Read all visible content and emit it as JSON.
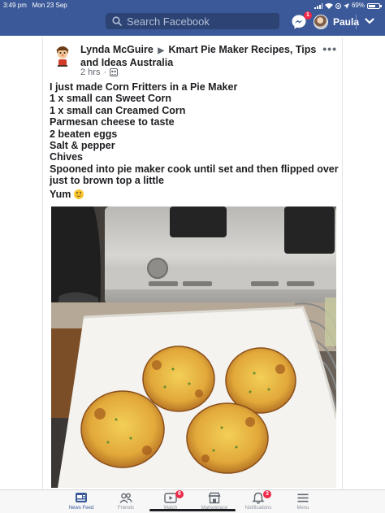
{
  "status_bar": {
    "time": "3:49 pm",
    "date": "Mon 23 Sep",
    "battery": "69%",
    "battery_level": 0.69
  },
  "header": {
    "search_placeholder": "Search Facebook",
    "messenger_badge": "1",
    "profile_name": "Paula"
  },
  "post": {
    "author": "Lynda McGuire",
    "group": "Kmart Pie Maker Recipes, Tips and Ideas Australia",
    "time_ago": "2 hrs",
    "audience_icon": "group-icon",
    "lines": [
      "I just made Corn Fritters in a Pie Maker",
      "1 x small can Sweet Corn",
      "1 x small can Creamed Corn",
      "Parmesan cheese to taste",
      "2 beaten eggs",
      "Salt & pepper",
      "Chives",
      "Spooned into pie maker cook until set and then flipped over just to brown top a little"
    ],
    "sign_off": "Yum",
    "sign_off_emoji": "smiling-face-emoji"
  },
  "tabs": [
    {
      "label": "News Feed",
      "icon": "news-feed-icon",
      "active": true,
      "badge": ""
    },
    {
      "label": "Friends",
      "icon": "friends-icon",
      "active": false,
      "badge": ""
    },
    {
      "label": "Watch",
      "icon": "watch-icon",
      "active": false,
      "badge": "6"
    },
    {
      "label": "Marketplace",
      "icon": "marketplace-icon",
      "active": false,
      "badge": ""
    },
    {
      "label": "Notifications",
      "icon": "bell-icon",
      "active": false,
      "badge": "3"
    },
    {
      "label": "Menu",
      "icon": "menu-icon",
      "active": false,
      "badge": ""
    }
  ],
  "colors": {
    "brand_blue": "#3b5998",
    "badge_red": "#f02849",
    "text": "#1c1e21",
    "secondary_text": "#606770"
  }
}
